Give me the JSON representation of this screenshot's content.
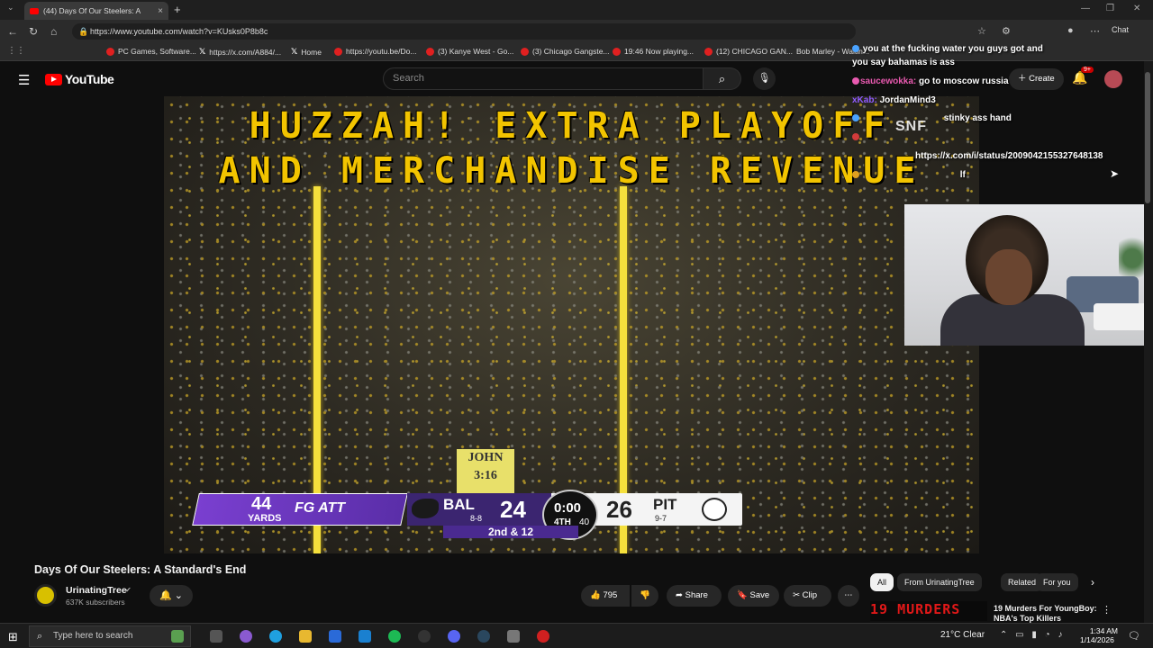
{
  "browser": {
    "tab_title": "(44) Days Of Our Steelers: A",
    "url": "https://www.youtube.com/watch?v=KUsks0P8b8c",
    "bookmarks": [
      {
        "label": "PC Games, Software..."
      },
      {
        "label": "https://x.com/A884/..."
      },
      {
        "label": "Home"
      },
      {
        "label": "https://youtu.be/Do..."
      },
      {
        "label": "(3) Kanye West - Go..."
      },
      {
        "label": "(3) Chicago Gangste..."
      },
      {
        "label": "19:46 Now playing..."
      },
      {
        "label": "(12) CHICAGO GAN..."
      },
      {
        "label": "Bob Marley - Waitin..."
      }
    ],
    "chat_button": "Chat"
  },
  "youtube": {
    "logo_text": "YouTube",
    "search_placeholder": "Search",
    "create_label": "Create",
    "notif_count": "9+"
  },
  "video": {
    "caption_line1": "HUZZAH! EXTRA PLAYOFF",
    "caption_line2": "AND MERCHANDISE REVENUE",
    "sign_text": "JOHN 3:16",
    "scorebug": {
      "yards_num": "44",
      "yards_label": "YARDS",
      "play": "FG ATT",
      "away_team": "BAL",
      "away_record": "8-8",
      "away_score": "24",
      "clock": "0:00",
      "quarter": "4TH",
      "timeout_time": "40",
      "home_score": "26",
      "home_team": "PIT",
      "home_record": "9-7",
      "down_distance": "2nd & 12"
    },
    "stream_overlay_logo": "SNF"
  },
  "chat": [
    {
      "user": "",
      "user_color": "#4aa3ff",
      "text": "you at the fucking water you guys got and"
    },
    {
      "user": "",
      "user_color": "#4aa3ff",
      "text": "you say bahamas is ass"
    },
    {
      "user": "saucewokka:",
      "user_color": "#e95ab0",
      "text": "go to moscow russia"
    },
    {
      "user": "xKab:",
      "user_color": "#8f5bff",
      "text": "JordanMind3"
    },
    {
      "user": "",
      "user_color": "#4aa3ff",
      "text": "stinky ass hand"
    },
    {
      "user": "",
      "user_color": "#d23b3b",
      "text": ""
    },
    {
      "user": "",
      "user_color": "#d23b3b",
      "text": "https://x.com/i/status/2009042155327648138"
    },
    {
      "user": "",
      "user_color": "#d23b3b",
      "text": "lf"
    }
  ],
  "below": {
    "title": "Days Of Our Steelers: A Standard's End",
    "channel_name": "UrinatingTree",
    "channel_subs": "637K subscribers",
    "like_count": "795",
    "share_label": "Share",
    "save_label": "Save",
    "clip_label": "Clip"
  },
  "chips": [
    "All",
    "From UrinatingTree",
    "Related",
    "For you"
  ],
  "recommendation": {
    "thumb_text": "19 MURDERS",
    "title_line1": "19 Murders For YoungBoy:",
    "title_line2": "NBA's Top Killers"
  },
  "taskbar": {
    "search_placeholder": "Type here to search",
    "weather": "21°C  Clear",
    "time": "1:34 AM",
    "date": "1/14/2026"
  }
}
